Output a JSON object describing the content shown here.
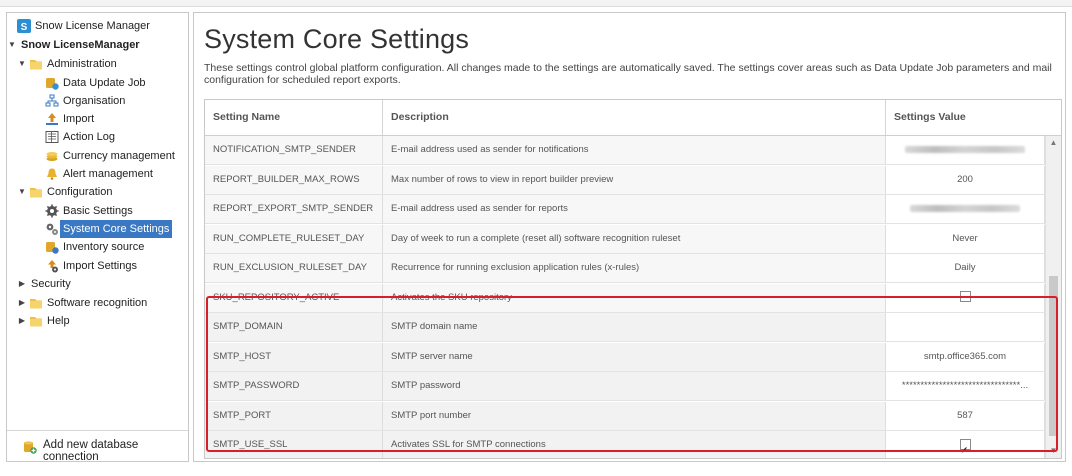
{
  "sidebar": {
    "root": "Snow License Manager",
    "tree": [
      {
        "id": "snow-licensemanager",
        "label": "Snow LicenseManager",
        "bold": true,
        "arrow": "▼"
      },
      {
        "id": "administration",
        "label": "Administration",
        "arrow": "▼",
        "icon": "folder-icon"
      },
      {
        "id": "data-update-job",
        "label": "Data Update Job",
        "icon": "data-update-icon"
      },
      {
        "id": "organisation",
        "label": "Organisation",
        "icon": "organisation-icon"
      },
      {
        "id": "import",
        "label": "Import",
        "icon": "import-icon"
      },
      {
        "id": "action-log",
        "label": "Action Log",
        "icon": "log-icon"
      },
      {
        "id": "currency-management",
        "label": "Currency management",
        "icon": "currency-icon"
      },
      {
        "id": "alert-management",
        "label": "Alert management",
        "icon": "bell-icon"
      },
      {
        "id": "configuration",
        "label": "Configuration",
        "arrow": "▼",
        "icon": "folder-icon"
      },
      {
        "id": "basic-settings",
        "label": "Basic Settings",
        "icon": "gear-icon"
      },
      {
        "id": "system-core-settings",
        "label": "System Core Settings",
        "icon": "gears-icon",
        "selected": true
      },
      {
        "id": "inventory-source",
        "label": "Inventory source",
        "icon": "inventory-icon"
      },
      {
        "id": "import-settings",
        "label": "Import Settings",
        "icon": "import-settings-icon"
      },
      {
        "id": "security",
        "label": "Security",
        "arrow": "▶"
      },
      {
        "id": "software-recognition",
        "label": "Software recognition",
        "arrow": "▶",
        "icon": "folder-icon"
      },
      {
        "id": "help",
        "label": "Help",
        "arrow": "▶",
        "icon": "folder-icon"
      }
    ],
    "footer": "Add new database connection"
  },
  "main": {
    "title": "System Core Settings",
    "description": "These settings control global platform configuration. All changes made to the settings are automatically saved. The settings cover areas such as Data Update Job parameters and mail configuration for scheduled report exports."
  },
  "grid": {
    "headers": [
      "Setting Name",
      "Description",
      "Settings Value"
    ],
    "rows": [
      {
        "name": "NOTIFICATION_SMTP_SENDER",
        "description": "E-mail address used as sender for notifications",
        "value": "",
        "kind": "blurred"
      },
      {
        "name": "REPORT_BUILDER_MAX_ROWS",
        "description": "Max number of rows to view in report builder preview",
        "value": "200",
        "kind": "text"
      },
      {
        "name": "REPORT_EXPORT_SMTP_SENDER",
        "description": "E-mail address used as sender for reports",
        "value": "",
        "kind": "blurred"
      },
      {
        "name": "RUN_COMPLETE_RULESET_DAY",
        "description": "Day of week to run a complete (reset all) software recognition ruleset",
        "value": "Never",
        "kind": "text"
      },
      {
        "name": "RUN_EXCLUSION_RULESET_DAY",
        "description": "Recurrence for running exclusion application rules (x-rules)",
        "value": "Daily",
        "kind": "text"
      },
      {
        "name": "SKU_REPOSITORY_ACTIVE",
        "description": "Activates the SKU repository",
        "value": "",
        "kind": "checkbox",
        "checked": false
      },
      {
        "name": "SMTP_DOMAIN",
        "description": "SMTP domain name",
        "value": "",
        "kind": "text"
      },
      {
        "name": "SMTP_HOST",
        "description": "SMTP server name",
        "value": "smtp.office365.com",
        "kind": "text"
      },
      {
        "name": "SMTP_PASSWORD",
        "description": "SMTP password",
        "value": "********************************...",
        "kind": "text"
      },
      {
        "name": "SMTP_PORT",
        "description": "SMTP port number",
        "value": "587",
        "kind": "text"
      },
      {
        "name": "SMTP_USE_SSL",
        "description": "Activates SSL for SMTP connections",
        "value": "",
        "kind": "checkbox",
        "checked": true
      }
    ]
  },
  "colors": {
    "selection": "#3a78c3",
    "highlight_border": "#d71f2a",
    "row_alt": "#f2f2f2"
  }
}
